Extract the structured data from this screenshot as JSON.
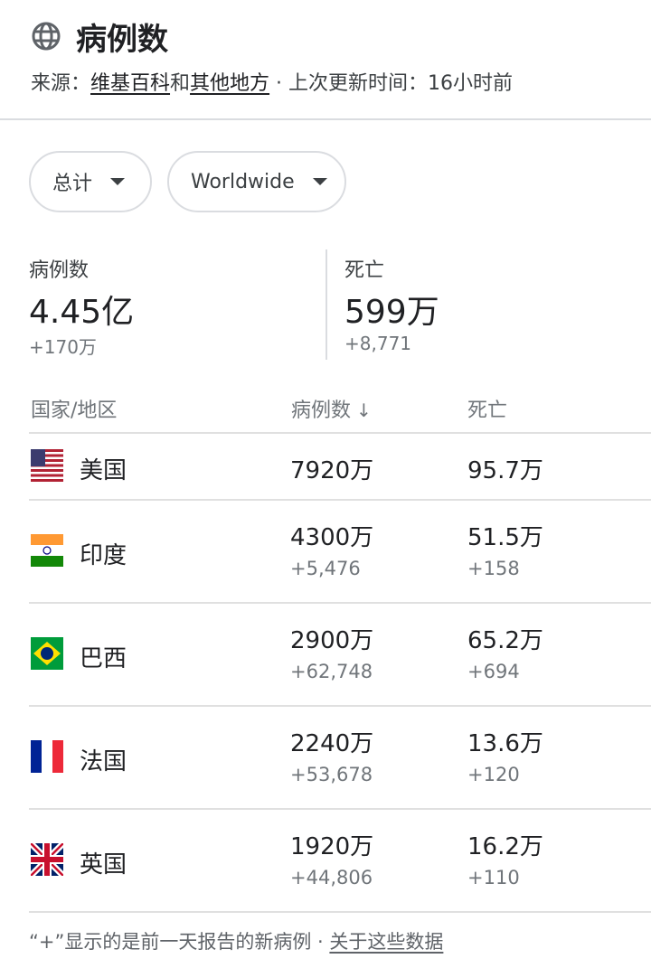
{
  "header": {
    "title": "病例数",
    "source_prefix": "来源：",
    "source_link1": "维基百科",
    "source_and": "和",
    "source_link2": "其他地方",
    "updated": " · 上次更新时间：16小时前"
  },
  "filters": {
    "scope_label": "总计",
    "region_label": "Worldwide"
  },
  "summary": {
    "cases_label": "病例数",
    "cases_value": "4.45亿",
    "cases_delta": "+170万",
    "deaths_label": "死亡",
    "deaths_value": "599万",
    "deaths_delta": "+8,771"
  },
  "table": {
    "headers": {
      "country": "国家/地区",
      "cases": "病例数",
      "cases_sort": "↓",
      "deaths": "死亡"
    },
    "rows": [
      {
        "country": "美国",
        "flag": "us-flag-icon",
        "cases": "7920万",
        "cases_delta": "",
        "deaths": "95.7万",
        "deaths_delta": ""
      },
      {
        "country": "印度",
        "flag": "india-flag-icon",
        "cases": "4300万",
        "cases_delta": "+5,476",
        "deaths": "51.5万",
        "deaths_delta": "+158"
      },
      {
        "country": "巴西",
        "flag": "brazil-flag-icon",
        "cases": "2900万",
        "cases_delta": "+62,748",
        "deaths": "65.2万",
        "deaths_delta": "+694"
      },
      {
        "country": "法国",
        "flag": "france-flag-icon",
        "cases": "2240万",
        "cases_delta": "+53,678",
        "deaths": "13.6万",
        "deaths_delta": "+120"
      },
      {
        "country": "英国",
        "flag": "uk-flag-icon",
        "cases": "1920万",
        "cases_delta": "+44,806",
        "deaths": "16.2万",
        "deaths_delta": "+110"
      }
    ]
  },
  "footer": {
    "note": "“+”显示的是前一天报告的新病例",
    "separator": " · ",
    "link": "关于这些数据"
  },
  "colors": {
    "text_primary": "#202124",
    "text_secondary": "#70757a",
    "divider": "#dadce0"
  },
  "icons": {
    "globe": "globe-icon",
    "dropdown": "caret-down-icon"
  }
}
